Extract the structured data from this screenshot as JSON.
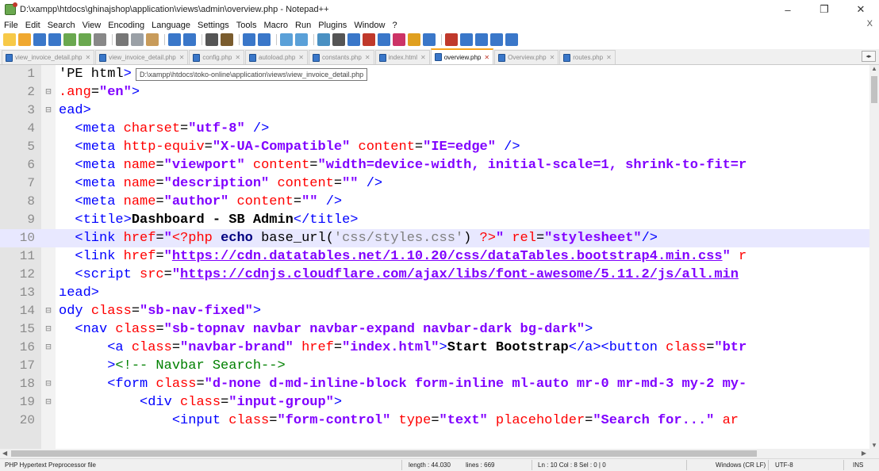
{
  "window": {
    "title": "D:\\xampp\\htdocs\\ghinajshop\\application\\views\\admin\\overview.php - Notepad++",
    "controls": {
      "minimize": "–",
      "maximize": "❐",
      "close": "✕"
    }
  },
  "menu": {
    "items": [
      "File",
      "Edit",
      "Search",
      "View",
      "Encoding",
      "Language",
      "Settings",
      "Tools",
      "Macro",
      "Run",
      "Plugins",
      "Window",
      "?"
    ],
    "close": "X"
  },
  "toolbar": {
    "icons": [
      {
        "name": "new-file-icon",
        "color": "#f7c948"
      },
      {
        "name": "open-file-icon",
        "color": "#f0a830"
      },
      {
        "name": "save-icon",
        "color": "#3a77c9"
      },
      {
        "name": "save-all-icon",
        "color": "#3a77c9"
      },
      {
        "name": "close-icon",
        "color": "#6aa84f"
      },
      {
        "name": "close-all-icon",
        "color": "#6aa84f"
      },
      {
        "name": "print-icon",
        "color": "#888888"
      },
      {
        "sep": true
      },
      {
        "name": "cut-icon",
        "color": "#777777"
      },
      {
        "name": "copy-icon",
        "color": "#9aa0a6"
      },
      {
        "name": "paste-icon",
        "color": "#c89b5a"
      },
      {
        "sep": true
      },
      {
        "name": "undo-icon",
        "color": "#3a77c9"
      },
      {
        "name": "redo-icon",
        "color": "#3a77c9"
      },
      {
        "sep": true
      },
      {
        "name": "find-icon",
        "color": "#555555"
      },
      {
        "name": "replace-icon",
        "color": "#7a5c2e"
      },
      {
        "sep": true
      },
      {
        "name": "zoom-in-icon",
        "color": "#3a77c9"
      },
      {
        "name": "zoom-out-icon",
        "color": "#3a77c9"
      },
      {
        "sep": true
      },
      {
        "name": "sync-v-icon",
        "color": "#5aa0d8"
      },
      {
        "name": "sync-h-icon",
        "color": "#5aa0d8"
      },
      {
        "sep": true
      },
      {
        "name": "word-wrap-icon",
        "color": "#4a90c2"
      },
      {
        "name": "all-chars-icon",
        "color": "#555555"
      },
      {
        "name": "indent-guide-icon",
        "color": "#3a77c9"
      },
      {
        "name": "udl-icon",
        "color": "#c0392b"
      },
      {
        "name": "doc-map-icon",
        "color": "#3a77c9"
      },
      {
        "name": "function-list-icon",
        "color": "#cc3366"
      },
      {
        "name": "folder-workspace-icon",
        "color": "#e0a020"
      },
      {
        "name": "monitoring-icon",
        "color": "#3a77c9"
      },
      {
        "sep": true
      },
      {
        "name": "record-macro-icon",
        "color": "#c0392b"
      },
      {
        "name": "stop-macro-icon",
        "color": "#3a77c9"
      },
      {
        "name": "play-macro-icon",
        "color": "#3a77c9"
      },
      {
        "name": "run-macro-multiple-icon",
        "color": "#3a77c9"
      },
      {
        "name": "save-macro-icon",
        "color": "#3a77c9"
      }
    ]
  },
  "tabs": [
    {
      "label": "view_invoice_detail.php",
      "active": false
    },
    {
      "label": "view_invoice_detail.php",
      "active": false
    },
    {
      "label": "config.php",
      "active": false
    },
    {
      "label": "autoload.php",
      "active": false
    },
    {
      "label": "constants.php",
      "active": false
    },
    {
      "label": "index.html",
      "active": false
    },
    {
      "label": "overview.php",
      "active": true
    },
    {
      "label": "Overview.php",
      "active": false
    },
    {
      "label": "routes.php",
      "active": false
    }
  ],
  "tab_scroll": "◂▸",
  "tooltip": "D:\\xampp\\htdocs\\toko-online\\application\\views\\view_invoice_detail.php",
  "editor": {
    "current_line": 10,
    "lines": [
      {
        "n": "1",
        "fold": "",
        "tokens": [
          [
            "tag",
            "​"
          ],
          [
            "plain",
            "'PE html"
          ],
          [
            "tag",
            ">"
          ]
        ]
      },
      {
        "n": "2",
        "fold": "⊟",
        "tokens": [
          [
            "attr",
            ".ang"
          ],
          [
            "plain",
            "="
          ],
          [
            "val",
            "\"en\""
          ],
          [
            "tag",
            ">"
          ]
        ]
      },
      {
        "n": "3",
        "fold": "⊟",
        "tokens": [
          [
            "tag",
            "ead>"
          ]
        ]
      },
      {
        "n": "4",
        "fold": "",
        "tokens": [
          [
            "plain",
            "  "
          ],
          [
            "tag",
            "<meta "
          ],
          [
            "attr",
            "charset"
          ],
          [
            "plain",
            "="
          ],
          [
            "val",
            "\"utf-8\""
          ],
          [
            "tag",
            " />"
          ]
        ]
      },
      {
        "n": "5",
        "fold": "",
        "tokens": [
          [
            "plain",
            "  "
          ],
          [
            "tag",
            "<meta "
          ],
          [
            "attr",
            "http-equiv"
          ],
          [
            "plain",
            "="
          ],
          [
            "val",
            "\"X-UA-Compatible\""
          ],
          [
            "attr",
            " content"
          ],
          [
            "plain",
            "="
          ],
          [
            "val",
            "\"IE=edge\""
          ],
          [
            "tag",
            " />"
          ]
        ]
      },
      {
        "n": "6",
        "fold": "",
        "tokens": [
          [
            "plain",
            "  "
          ],
          [
            "tag",
            "<meta "
          ],
          [
            "attr",
            "name"
          ],
          [
            "plain",
            "="
          ],
          [
            "val",
            "\"viewport\""
          ],
          [
            "attr",
            " content"
          ],
          [
            "plain",
            "="
          ],
          [
            "val",
            "\"width=device-width, initial-scale=1, shrink-to-fit=r"
          ]
        ]
      },
      {
        "n": "7",
        "fold": "",
        "tokens": [
          [
            "plain",
            "  "
          ],
          [
            "tag",
            "<meta "
          ],
          [
            "attr",
            "name"
          ],
          [
            "plain",
            "="
          ],
          [
            "val",
            "\"description\""
          ],
          [
            "attr",
            " content"
          ],
          [
            "plain",
            "="
          ],
          [
            "val",
            "\"\""
          ],
          [
            "tag",
            " />"
          ]
        ]
      },
      {
        "n": "8",
        "fold": "",
        "tokens": [
          [
            "plain",
            "  "
          ],
          [
            "tag",
            "<meta "
          ],
          [
            "attr",
            "name"
          ],
          [
            "plain",
            "="
          ],
          [
            "val",
            "\"author\""
          ],
          [
            "attr",
            " content"
          ],
          [
            "plain",
            "="
          ],
          [
            "val",
            "\"\""
          ],
          [
            "tag",
            " />"
          ]
        ]
      },
      {
        "n": "9",
        "fold": "",
        "tokens": [
          [
            "plain",
            "  "
          ],
          [
            "tag",
            "<title>"
          ],
          [
            "txt",
            "Dashboard - SB Admin"
          ],
          [
            "tag",
            "</title>"
          ]
        ]
      },
      {
        "n": "10",
        "fold": "",
        "tokens": [
          [
            "plain",
            "  "
          ],
          [
            "tag",
            "<link "
          ],
          [
            "attr",
            "href"
          ],
          [
            "plain",
            "="
          ],
          [
            "val",
            "\""
          ],
          [
            "php",
            "<?php "
          ],
          [
            "kw",
            "echo"
          ],
          [
            "fn",
            " base_url("
          ],
          [
            "str",
            "'css/styles.css'"
          ],
          [
            "fn",
            ") "
          ],
          [
            "php",
            "?>"
          ],
          [
            "val",
            "\""
          ],
          [
            "attr",
            " rel"
          ],
          [
            "plain",
            "="
          ],
          [
            "val",
            "\"stylesheet\""
          ],
          [
            "tag",
            "/>"
          ]
        ]
      },
      {
        "n": "11",
        "fold": "",
        "tokens": [
          [
            "plain",
            "  "
          ],
          [
            "tag",
            "<link "
          ],
          [
            "attr",
            "href"
          ],
          [
            "plain",
            "="
          ],
          [
            "val",
            "\""
          ],
          [
            "url",
            "https://cdn.datatables.net/1.10.20/css/dataTables.bootstrap4.min.css"
          ],
          [
            "val",
            "\""
          ],
          [
            "attr",
            " r"
          ]
        ]
      },
      {
        "n": "12",
        "fold": "",
        "tokens": [
          [
            "plain",
            "  "
          ],
          [
            "tag",
            "<script "
          ],
          [
            "attr",
            "src"
          ],
          [
            "plain",
            "="
          ],
          [
            "val",
            "\""
          ],
          [
            "url",
            "https://cdnjs.cloudflare.com/ajax/libs/font-awesome/5.11.2/js/all.min"
          ]
        ]
      },
      {
        "n": "13",
        "fold": "",
        "tokens": [
          [
            "tag",
            "ıead>"
          ]
        ]
      },
      {
        "n": "14",
        "fold": "⊟",
        "tokens": [
          [
            "tag",
            "ody "
          ],
          [
            "attr",
            "class"
          ],
          [
            "plain",
            "="
          ],
          [
            "val",
            "\"sb-nav-fixed\""
          ],
          [
            "tag",
            ">"
          ]
        ]
      },
      {
        "n": "15",
        "fold": "⊟",
        "tokens": [
          [
            "plain",
            "  "
          ],
          [
            "tag",
            "<nav "
          ],
          [
            "attr",
            "class"
          ],
          [
            "plain",
            "="
          ],
          [
            "val",
            "\"sb-topnav navbar navbar-expand navbar-dark bg-dark\""
          ],
          [
            "tag",
            ">"
          ]
        ]
      },
      {
        "n": "16",
        "fold": "⊟",
        "tokens": [
          [
            "plain",
            "      "
          ],
          [
            "tag",
            "<a "
          ],
          [
            "attr",
            "class"
          ],
          [
            "plain",
            "="
          ],
          [
            "val",
            "\"navbar-brand\""
          ],
          [
            "attr",
            " href"
          ],
          [
            "plain",
            "="
          ],
          [
            "val",
            "\"index.html\""
          ],
          [
            "tag",
            ">"
          ],
          [
            "txt",
            "Start Bootstrap"
          ],
          [
            "tag",
            "</a><button "
          ],
          [
            "attr",
            "class"
          ],
          [
            "plain",
            "="
          ],
          [
            "val",
            "\"btr"
          ]
        ]
      },
      {
        "n": "17",
        "fold": "",
        "tokens": [
          [
            "plain",
            "      "
          ],
          [
            "tag",
            ">"
          ],
          [
            "com",
            "<!-- Navbar Search-->"
          ]
        ]
      },
      {
        "n": "18",
        "fold": "⊟",
        "tokens": [
          [
            "plain",
            "      "
          ],
          [
            "tag",
            "<form "
          ],
          [
            "attr",
            "class"
          ],
          [
            "plain",
            "="
          ],
          [
            "val",
            "\"d-none d-md-inline-block form-inline ml-auto mr-0 mr-md-3 my-2 my-"
          ]
        ]
      },
      {
        "n": "19",
        "fold": "⊟",
        "tokens": [
          [
            "plain",
            "          "
          ],
          [
            "tag",
            "<div "
          ],
          [
            "attr",
            "class"
          ],
          [
            "plain",
            "="
          ],
          [
            "val",
            "\"input-group\""
          ],
          [
            "tag",
            ">"
          ]
        ]
      },
      {
        "n": "20",
        "fold": "",
        "tokens": [
          [
            "plain",
            "              "
          ],
          [
            "tag",
            "<input "
          ],
          [
            "attr",
            "class"
          ],
          [
            "plain",
            "="
          ],
          [
            "val",
            "\"form-control\""
          ],
          [
            "attr",
            " type"
          ],
          [
            "plain",
            "="
          ],
          [
            "val",
            "\"text\""
          ],
          [
            "attr",
            " placeholder"
          ],
          [
            "plain",
            "="
          ],
          [
            "val",
            "\"Search for...\""
          ],
          [
            "attr",
            " ar"
          ]
        ]
      }
    ]
  },
  "status": {
    "file_type": "PHP Hypertext Preprocessor file",
    "length": "length : 44.030",
    "lines": "lines : 669",
    "position": "Ln : 10   Col : 8   Sel : 0 | 0",
    "eol": "Windows (CR LF)",
    "encoding": "UTF-8",
    "mode": "INS"
  }
}
